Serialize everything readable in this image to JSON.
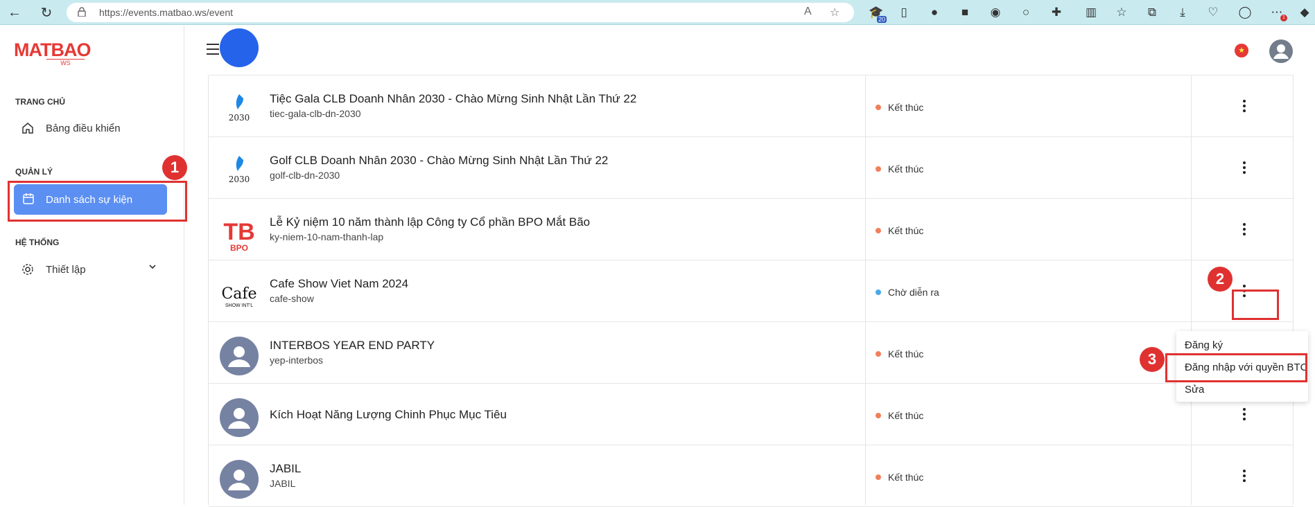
{
  "browser": {
    "url": "https://events.matbao.ws/event",
    "ext_badge_count": "20"
  },
  "sidebar": {
    "logo_text": "MATBAO",
    "logo_sub": "WS",
    "sections": [
      {
        "title": "TRANG CHỦ",
        "items": [
          {
            "label": "Bảng điều khiển",
            "icon": "home-icon"
          }
        ]
      },
      {
        "title": "QUẢN LÝ",
        "items": [
          {
            "label": "Danh sách sự kiện",
            "icon": "calendar-icon",
            "active": true
          }
        ]
      },
      {
        "title": "HỆ THỐNG",
        "items": [
          {
            "label": "Thiết lập",
            "icon": "gear-icon"
          }
        ]
      }
    ]
  },
  "events": [
    {
      "title": "Tiệc Gala CLB Doanh Nhân 2030 - Chào Mừng Sinh Nhật Lần Thứ 22",
      "slug": "tiec-gala-clb-dn-2030",
      "status": "Kết thúc",
      "status_color": "#f0805a",
      "thumb_text": "2030"
    },
    {
      "title": "Golf CLB Doanh Nhân 2030 - Chào Mừng Sinh Nhật Lần Thứ 22",
      "slug": "golf-clb-dn-2030",
      "status": "Kết thúc",
      "status_color": "#f0805a",
      "thumb_text": "2030"
    },
    {
      "title": "Lễ Kỷ niệm 10 năm thành lập Công ty Cổ phần BPO Mắt Bão",
      "slug": "ky-niem-10-nam-thanh-lap",
      "status": "Kết thúc",
      "status_color": "#f0805a",
      "thumb_text": "TB"
    },
    {
      "title": "Cafe Show Viet Nam 2024",
      "slug": "cafe-show",
      "status": "Chờ diễn ra",
      "status_color": "#4aa8e8",
      "thumb_text": "Cafe"
    },
    {
      "title": "INTERBOS YEAR END PARTY",
      "slug": "yep-interbos",
      "status": "Kết thúc",
      "status_color": "#f0805a"
    },
    {
      "title": "Kích Hoạt Năng Lượng Chinh Phục Mục Tiêu",
      "slug": "",
      "status": "Kết thúc",
      "status_color": "#f0805a"
    },
    {
      "title": "JABIL",
      "slug": "JABIL",
      "status": "Kết thúc",
      "status_color": "#f0805a"
    }
  ],
  "dropdown": {
    "items": [
      "Đăng ký",
      "Đăng nhập với quyền BTC",
      "Sửa"
    ]
  },
  "annotations": {
    "badges": [
      "1",
      "2",
      "3"
    ],
    "color": "#e03131"
  }
}
